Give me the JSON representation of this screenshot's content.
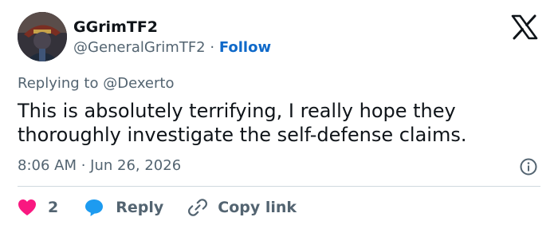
{
  "author": {
    "display_name": "GGrimTF2",
    "handle": "@GeneralGrimTF2",
    "separator": "·",
    "follow_label": "Follow",
    "avatar_icon": "profile-avatar"
  },
  "platform_logo": "x-logo-icon",
  "reply_context": {
    "prefix": "Replying to",
    "handle": "@Dexerto"
  },
  "tweet": {
    "text": "This is absolutely terrifying, I really hope they thoroughly investigate the self-defense claims.",
    "timestamp": "8:06 AM · Jun 26, 2026"
  },
  "actions": {
    "like_count": "2",
    "reply_label": "Reply",
    "copy_link_label": "Copy link"
  },
  "colors": {
    "text": "#0f1419",
    "secondary": "#536471",
    "link": "#0f69c9",
    "like": "#f91880",
    "reply_icon": "#1d9bf0",
    "divider": "#cfd9de"
  }
}
